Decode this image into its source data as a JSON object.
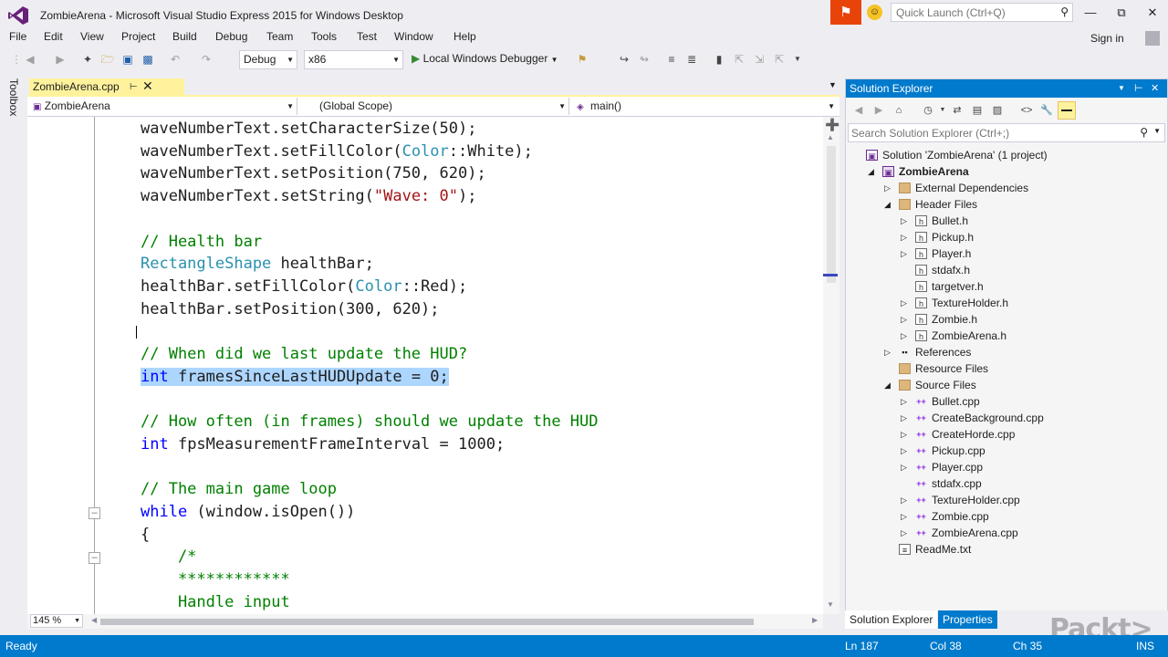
{
  "app": {
    "title": "ZombieArena - Microsoft Visual Studio Express 2015 for Windows Desktop",
    "quick_launch_placeholder": "Quick Launch (Ctrl+Q)",
    "sign_in": "Sign in",
    "accent": "#007acc"
  },
  "menu": [
    "File",
    "Edit",
    "View",
    "Project",
    "Build",
    "Debug",
    "Team",
    "Tools",
    "Test",
    "Window",
    "Help"
  ],
  "toolbar": {
    "configuration": "Debug",
    "platform": "x86",
    "start_debugger": "Local Windows Debugger"
  },
  "toolbox_label": "Toolbox",
  "document": {
    "tab_name": "ZombieArena.cpp",
    "nav_project": "ZombieArena",
    "nav_scope": "(Global Scope)",
    "nav_member": "main()",
    "zoom": "145 %"
  },
  "code_lines": [
    [
      {
        "t": "waveNumberText.setCharacterSize(50);",
        "c": "n"
      }
    ],
    [
      {
        "t": "waveNumberText.setFillColor(",
        "c": "n"
      },
      {
        "t": "Color",
        "c": "ty"
      },
      {
        "t": "::White);",
        "c": "n"
      }
    ],
    [
      {
        "t": "waveNumberText.setPosition(750, 620);",
        "c": "n"
      }
    ],
    [
      {
        "t": "waveNumberText.setString(",
        "c": "n"
      },
      {
        "t": "\"Wave: 0\"",
        "c": "st"
      },
      {
        "t": ");",
        "c": "n"
      }
    ],
    [],
    [
      {
        "t": "// Health bar",
        "c": "cm"
      }
    ],
    [
      {
        "t": "RectangleShape",
        "c": "ty"
      },
      {
        "t": " healthBar;",
        "c": "n"
      }
    ],
    [
      {
        "t": "healthBar.setFillColor(",
        "c": "n"
      },
      {
        "t": "Color",
        "c": "ty"
      },
      {
        "t": "::Red);",
        "c": "n"
      }
    ],
    [
      {
        "t": "healthBar.setPosition(300, 620);",
        "c": "n"
      }
    ],
    [],
    [
      {
        "t": "// When did we last update the HUD?",
        "c": "cm"
      }
    ],
    [
      {
        "t": "int",
        "c": "kw",
        "sel": true
      },
      {
        "t": " framesSinceLastHUDUpdate = 0;",
        "c": "n",
        "sel": true
      }
    ],
    [],
    [
      {
        "t": "// How often (in frames) should we update the HUD",
        "c": "cm"
      }
    ],
    [
      {
        "t": "int",
        "c": "kw"
      },
      {
        "t": " fpsMeasurementFrameInterval = 1000;",
        "c": "n"
      }
    ],
    [],
    [
      {
        "t": "// The main game loop",
        "c": "cm"
      }
    ],
    [
      {
        "t": "while",
        "c": "kw"
      },
      {
        "t": " (window.isOpen())",
        "c": "n"
      }
    ],
    [
      {
        "t": "{",
        "c": "n"
      }
    ],
    [
      {
        "t": "    /*",
        "c": "cm"
      }
    ],
    [
      {
        "t": "    ************",
        "c": "cm"
      }
    ],
    [
      {
        "t": "    Handle input",
        "c": "cm"
      }
    ]
  ],
  "solution_explorer": {
    "title": "Solution Explorer",
    "search_placeholder": "Search Solution Explorer (Ctrl+;)",
    "tree": [
      {
        "label": "Solution 'ZombieArena' (1 project)",
        "level": 0,
        "icon": "sln",
        "expander": ""
      },
      {
        "label": "ZombieArena",
        "level": 1,
        "icon": "proj",
        "expander": "open",
        "bold": true
      },
      {
        "label": "External Dependencies",
        "level": 2,
        "icon": "folder",
        "expander": "closed"
      },
      {
        "label": "Header Files",
        "level": 2,
        "icon": "folder",
        "expander": "open"
      },
      {
        "label": "Bullet.h",
        "level": 3,
        "icon": "h",
        "expander": "closed"
      },
      {
        "label": "Pickup.h",
        "level": 3,
        "icon": "h",
        "expander": "closed"
      },
      {
        "label": "Player.h",
        "level": 3,
        "icon": "h",
        "expander": "closed"
      },
      {
        "label": "stdafx.h",
        "level": 3,
        "icon": "h",
        "expander": ""
      },
      {
        "label": "targetver.h",
        "level": 3,
        "icon": "h",
        "expander": ""
      },
      {
        "label": "TextureHolder.h",
        "level": 3,
        "icon": "h",
        "expander": "closed"
      },
      {
        "label": "Zombie.h",
        "level": 3,
        "icon": "h",
        "expander": "closed"
      },
      {
        "label": "ZombieArena.h",
        "level": 3,
        "icon": "h",
        "expander": "closed"
      },
      {
        "label": "References",
        "level": 2,
        "icon": "ref",
        "expander": "closed"
      },
      {
        "label": "Resource Files",
        "level": 2,
        "icon": "folder",
        "expander": ""
      },
      {
        "label": "Source Files",
        "level": 2,
        "icon": "folder",
        "expander": "open"
      },
      {
        "label": "Bullet.cpp",
        "level": 3,
        "icon": "cpp",
        "expander": "closed"
      },
      {
        "label": "CreateBackground.cpp",
        "level": 3,
        "icon": "cpp",
        "expander": "closed"
      },
      {
        "label": "CreateHorde.cpp",
        "level": 3,
        "icon": "cpp",
        "expander": "closed"
      },
      {
        "label": "Pickup.cpp",
        "level": 3,
        "icon": "cpp",
        "expander": "closed"
      },
      {
        "label": "Player.cpp",
        "level": 3,
        "icon": "cpp",
        "expander": "closed"
      },
      {
        "label": "stdafx.cpp",
        "level": 3,
        "icon": "cpp",
        "expander": ""
      },
      {
        "label": "TextureHolder.cpp",
        "level": 3,
        "icon": "cpp",
        "expander": "closed"
      },
      {
        "label": "Zombie.cpp",
        "level": 3,
        "icon": "cpp",
        "expander": "closed"
      },
      {
        "label": "ZombieArena.cpp",
        "level": 3,
        "icon": "cpp",
        "expander": "closed"
      },
      {
        "label": "ReadMe.txt",
        "level": 2,
        "icon": "txt",
        "expander": ""
      }
    ],
    "bottom_tabs": [
      "Solution Explorer",
      "Properties"
    ]
  },
  "status": {
    "state": "Ready",
    "line": "Ln 187",
    "col": "Col 38",
    "ch": "Ch 35",
    "mode": "INS"
  },
  "watermark": "Packt>"
}
